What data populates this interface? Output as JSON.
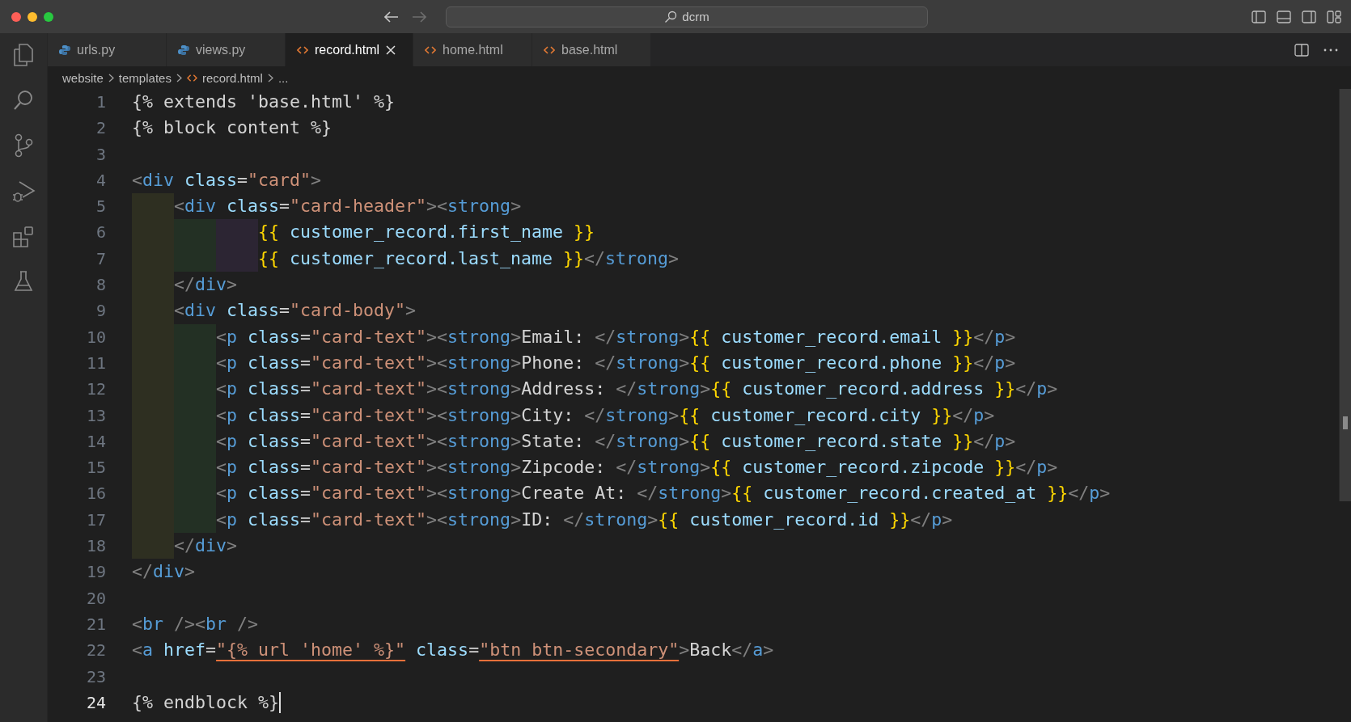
{
  "window": {
    "search": "dcrm"
  },
  "tabs": [
    {
      "label": "urls.py",
      "kind": "python",
      "selected": false
    },
    {
      "label": "views.py",
      "kind": "python",
      "selected": false
    },
    {
      "label": "record.html",
      "kind": "html",
      "selected": true
    },
    {
      "label": "home.html",
      "kind": "html",
      "selected": false
    },
    {
      "label": "base.html",
      "kind": "html",
      "selected": false
    }
  ],
  "breadcrumb": [
    {
      "label": "website",
      "kind": "folder"
    },
    {
      "label": "templates",
      "kind": "folder"
    },
    {
      "label": "record.html",
      "kind": "html"
    },
    {
      "label": "...",
      "kind": "more"
    }
  ],
  "editor": {
    "lines": [
      {
        "number": "1",
        "text": "{% extends 'base.html' %}"
      },
      {
        "number": "2",
        "text": "{% block content %}"
      },
      {
        "number": "3"
      },
      {
        "number": "4",
        "text": "<div class=\"card\">"
      },
      {
        "number": "5",
        "text": "    <div class=\"card-header\"><strong>"
      },
      {
        "number": "6",
        "text": "            {{ customer_record.first_name }}"
      },
      {
        "number": "7",
        "text": "            {{ customer_record.last_name }}</strong>"
      },
      {
        "number": "8",
        "text": "    </div>"
      },
      {
        "number": "9",
        "text": "    <div class=\"card-body\">"
      },
      {
        "number": "10",
        "text": "        <p class=\"card-text\"><strong>Email: </strong>{{ customer_record.email }}</p>"
      },
      {
        "number": "11",
        "text": "        <p class=\"card-text\"><strong>Phone: </strong>{{ customer_record.phone }}</p>"
      },
      {
        "number": "12",
        "text": "        <p class=\"card-text\"><strong>Address: </strong>{{ customer_record.address }}</p>"
      },
      {
        "number": "13",
        "text": "        <p class=\"card-text\"><strong>City: </strong>{{ customer_record.city }}</p>"
      },
      {
        "number": "14",
        "text": "        <p class=\"card-text\"><strong>State: </strong>{{ customer_record.state }}</p>"
      },
      {
        "number": "15",
        "text": "        <p class=\"card-text\"><strong>Zipcode: </strong>{{ customer_record.zipcode }}</p>"
      },
      {
        "number": "16",
        "text": "        <p class=\"card-text\"><strong>Create At: </strong>{{ customer_record.created_at }}</p>"
      },
      {
        "number": "17",
        "text": "        <p class=\"card-text\"><strong>ID: </strong>{{ customer_record.id }}</p>"
      },
      {
        "number": "18",
        "text": "    </div>"
      },
      {
        "number": "19",
        "text": "</div>"
      },
      {
        "number": "20"
      },
      {
        "number": "21",
        "text": "<br /><br />"
      },
      {
        "number": "22",
        "text": "<a href=\"{% url 'home' %}\" class=\"btn btn-secondary\">Back</a>",
        "squiggle": true
      },
      {
        "number": "23"
      },
      {
        "number": "24",
        "text": "{% endblock %}",
        "cursor": true
      }
    ]
  }
}
